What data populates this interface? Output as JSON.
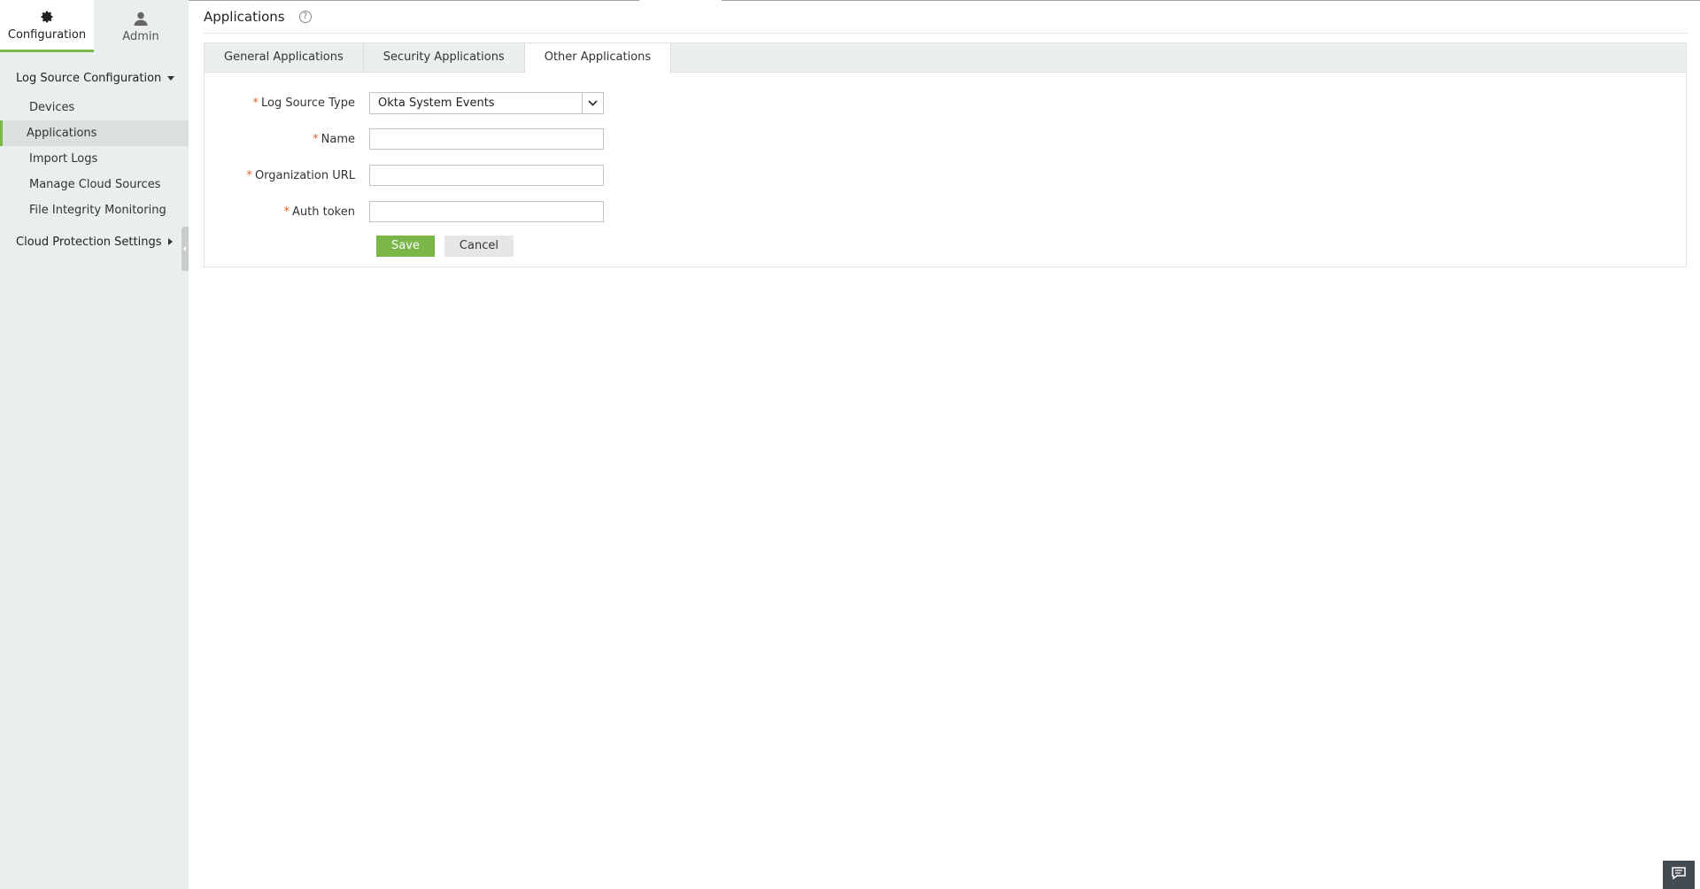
{
  "top_tabs": [
    {
      "label": "Configuration",
      "icon": "gear-icon"
    },
    {
      "label": "Admin",
      "icon": "user-icon"
    }
  ],
  "nav": {
    "group1": {
      "label": "Log Source Configuration"
    },
    "items": [
      {
        "label": "Devices"
      },
      {
        "label": "Applications"
      },
      {
        "label": "Import Logs"
      },
      {
        "label": "Manage Cloud Sources"
      },
      {
        "label": "File Integrity Monitoring"
      }
    ],
    "group2": {
      "label": "Cloud Protection Settings"
    }
  },
  "header": {
    "title": "Applications",
    "help": "?"
  },
  "tabs": [
    {
      "label": "General Applications"
    },
    {
      "label": "Security Applications"
    },
    {
      "label": "Other Applications"
    }
  ],
  "form": {
    "required_mark": "*",
    "log_source_type": {
      "label": "Log Source Type",
      "value": "Okta System Events"
    },
    "name": {
      "label": "Name",
      "value": ""
    },
    "org_url": {
      "label": "Organization URL",
      "value": ""
    },
    "auth_token": {
      "label": "Auth token",
      "value": ""
    },
    "save_label": "Save",
    "cancel_label": "Cancel"
  },
  "colors": {
    "accent": "#7ab648",
    "required": "#e5652c",
    "sidebar": "#eaeeee"
  }
}
